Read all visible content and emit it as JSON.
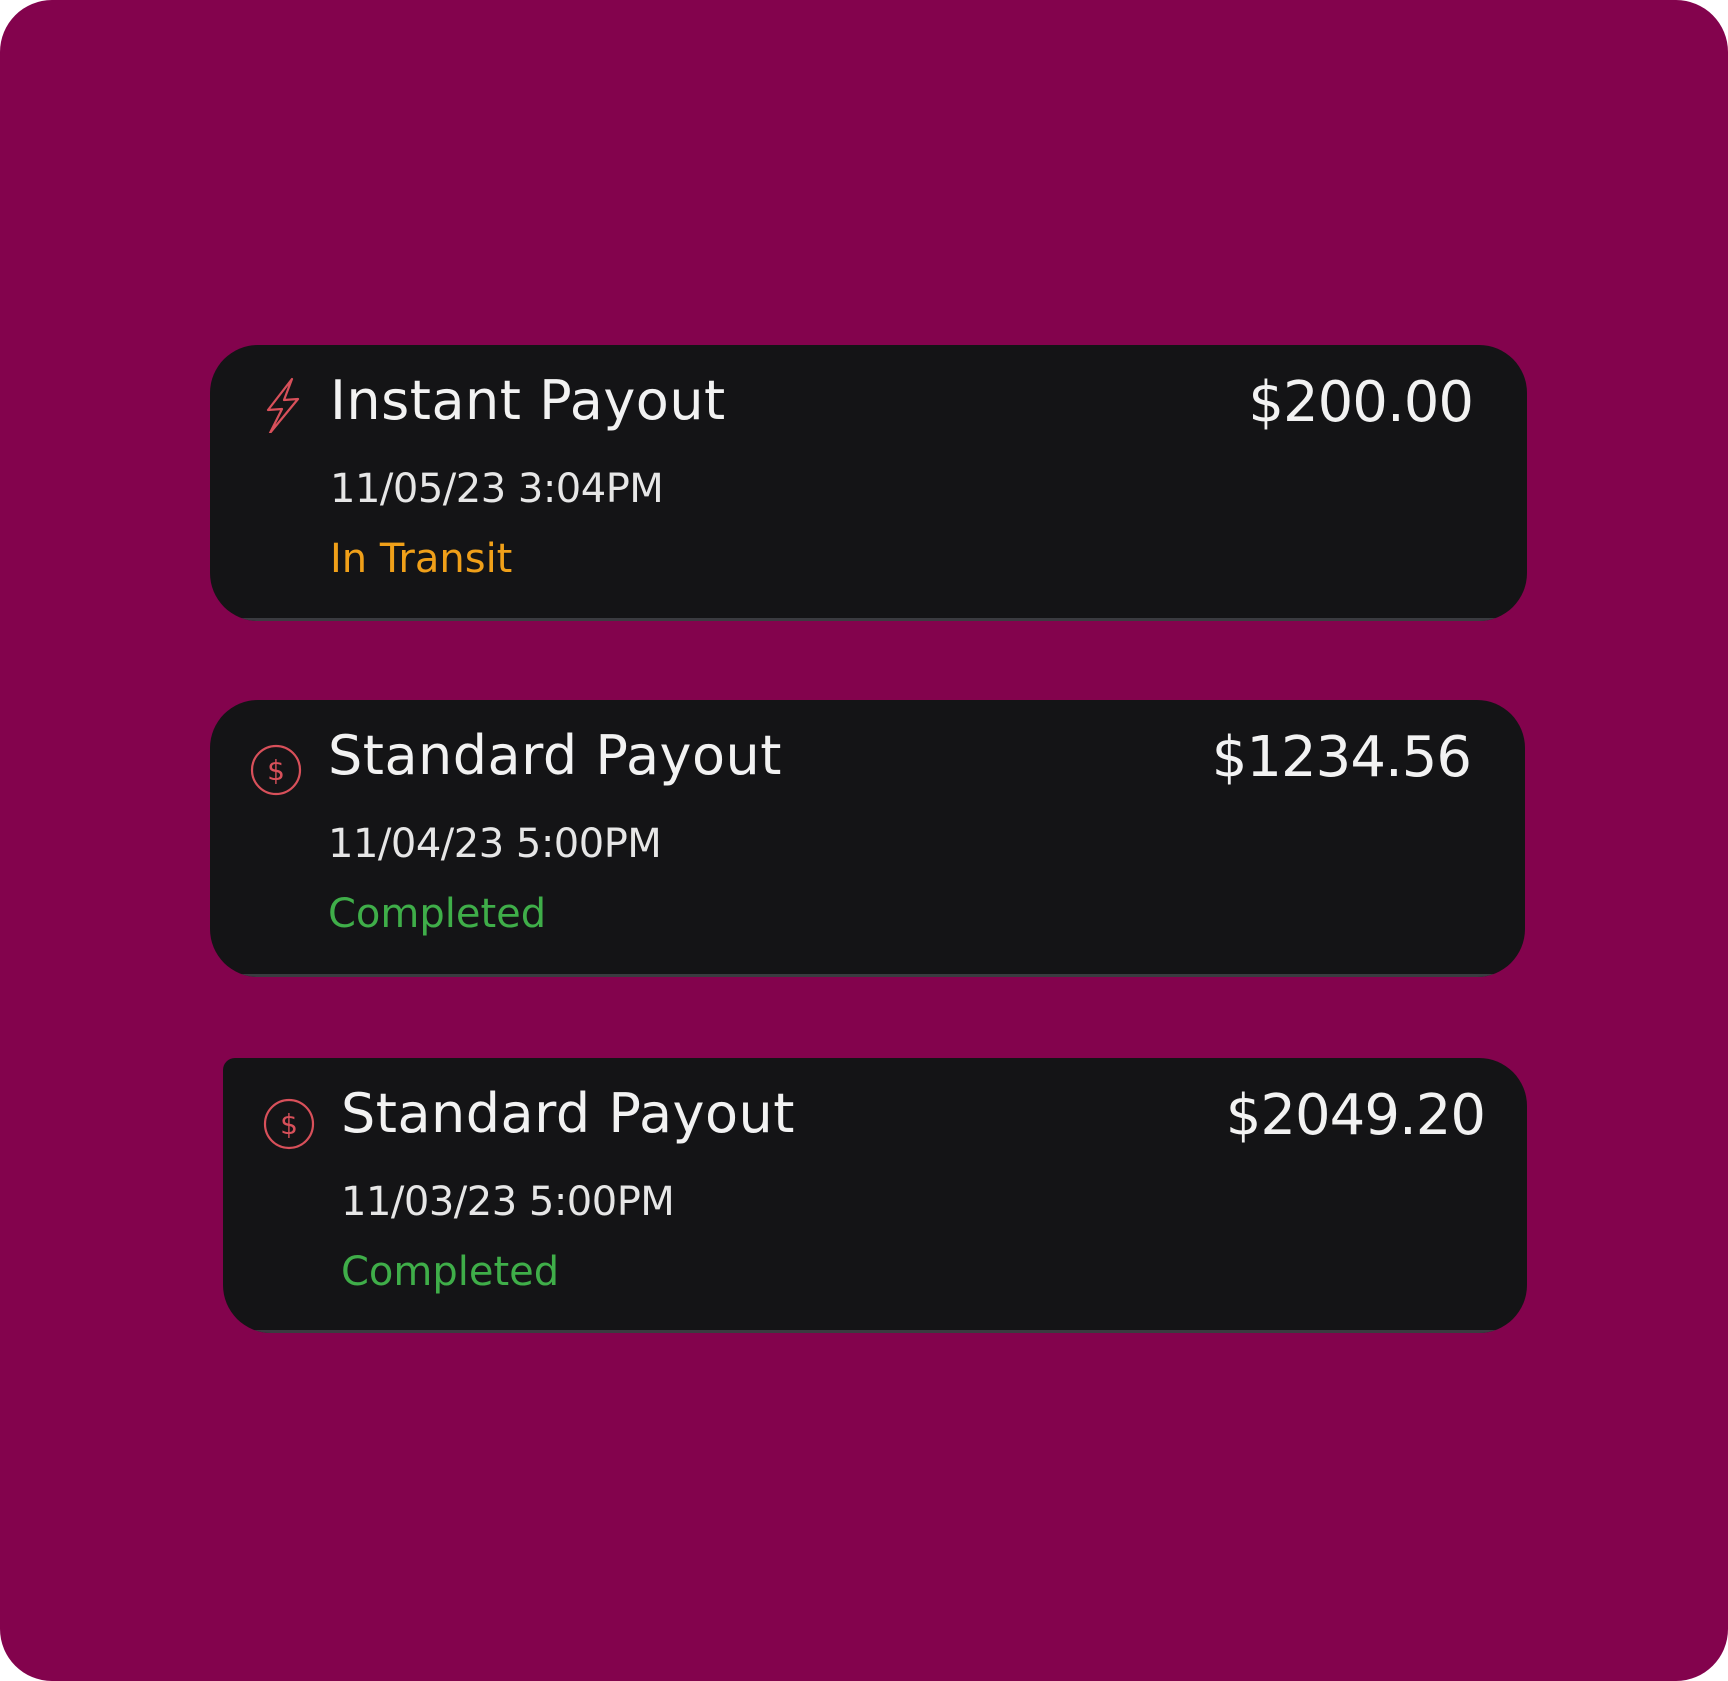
{
  "colors": {
    "background": "#83034d",
    "card": "#141416",
    "text_primary": "#f2f2f2",
    "status_in_transit": "#f0a019",
    "status_completed": "#3fae49",
    "icon_accent": "#d8505a"
  },
  "payouts": [
    {
      "icon": "lightning-icon",
      "title": "Instant Payout",
      "amount": "$200.00",
      "datetime": "11/05/23 3:04PM",
      "status": "In Transit",
      "status_color": "#f0a019"
    },
    {
      "icon": "dollar-circle-icon",
      "title": "Standard Payout",
      "amount": "$1234.56",
      "datetime": "11/04/23 5:00PM",
      "status": "Completed",
      "status_color": "#3fae49"
    },
    {
      "icon": "dollar-circle-icon",
      "title": "Standard Payout",
      "amount": "$2049.20",
      "datetime": "11/03/23 5:00PM",
      "status": "Completed",
      "status_color": "#3fae49"
    }
  ]
}
